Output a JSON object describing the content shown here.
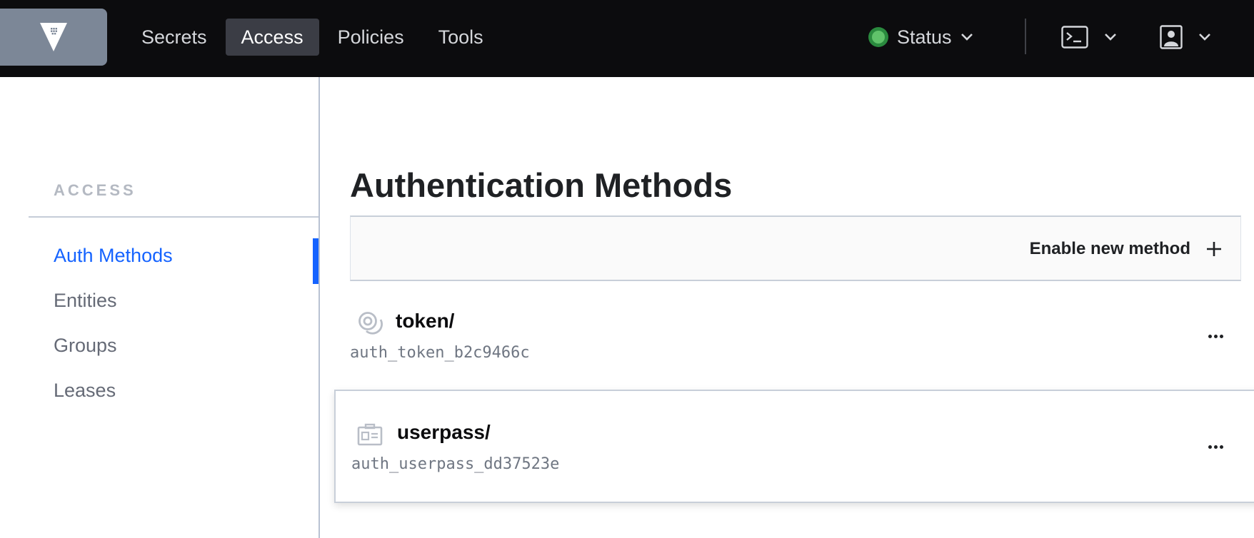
{
  "nav": {
    "links": [
      {
        "label": "Secrets",
        "active": false
      },
      {
        "label": "Access",
        "active": true
      },
      {
        "label": "Policies",
        "active": false
      },
      {
        "label": "Tools",
        "active": false
      }
    ],
    "status_label": "Status",
    "icons": {
      "logo": "vault-logo-icon",
      "status": "status-dot-icon",
      "console": "terminal-icon",
      "user": "user-icon",
      "dropdown": "chevron-down-icon"
    },
    "colors": {
      "status_ok": "#60c26a",
      "active_tab": "#3b3d45"
    }
  },
  "sidebar": {
    "heading": "ACCESS",
    "items": [
      {
        "label": "Auth Methods",
        "active": true
      },
      {
        "label": "Entities",
        "active": false
      },
      {
        "label": "Groups",
        "active": false
      },
      {
        "label": "Leases",
        "active": false
      }
    ],
    "accent_color": "#1563ff"
  },
  "main": {
    "title": "Authentication Methods",
    "enable_label": "Enable new method",
    "methods": [
      {
        "path": "token/",
        "accessor": "auth_token_b2c9466c",
        "icon": "token-icon"
      },
      {
        "path": "userpass/",
        "accessor": "auth_userpass_dd37523e",
        "icon": "user-card-icon"
      }
    ]
  }
}
